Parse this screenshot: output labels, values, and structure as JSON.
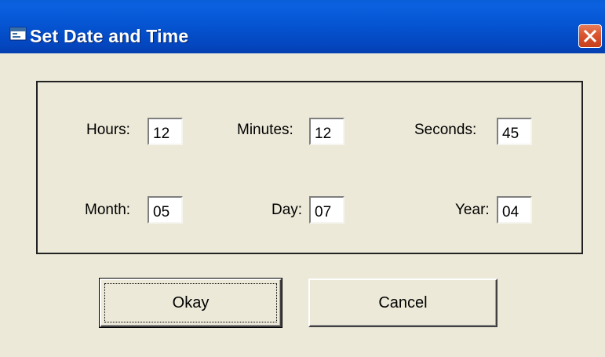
{
  "window": {
    "title": "Set Date and Time",
    "icon": "app-window-icon",
    "close_icon": "close-icon"
  },
  "fields": {
    "hours": {
      "label": "Hours:",
      "value": "12"
    },
    "minutes": {
      "label": "Minutes:",
      "value": "12"
    },
    "seconds": {
      "label": "Seconds:",
      "value": "45"
    },
    "month": {
      "label": "Month:",
      "value": "05"
    },
    "day": {
      "label": "Day:",
      "value": "07"
    },
    "year": {
      "label": "Year:",
      "value": "04"
    }
  },
  "buttons": {
    "okay_label": "Okay",
    "cancel_label": "Cancel"
  },
  "colors": {
    "titlebar": "#0553d0",
    "dialog_background": "#ece9d8",
    "close_button": "#d9552f"
  }
}
